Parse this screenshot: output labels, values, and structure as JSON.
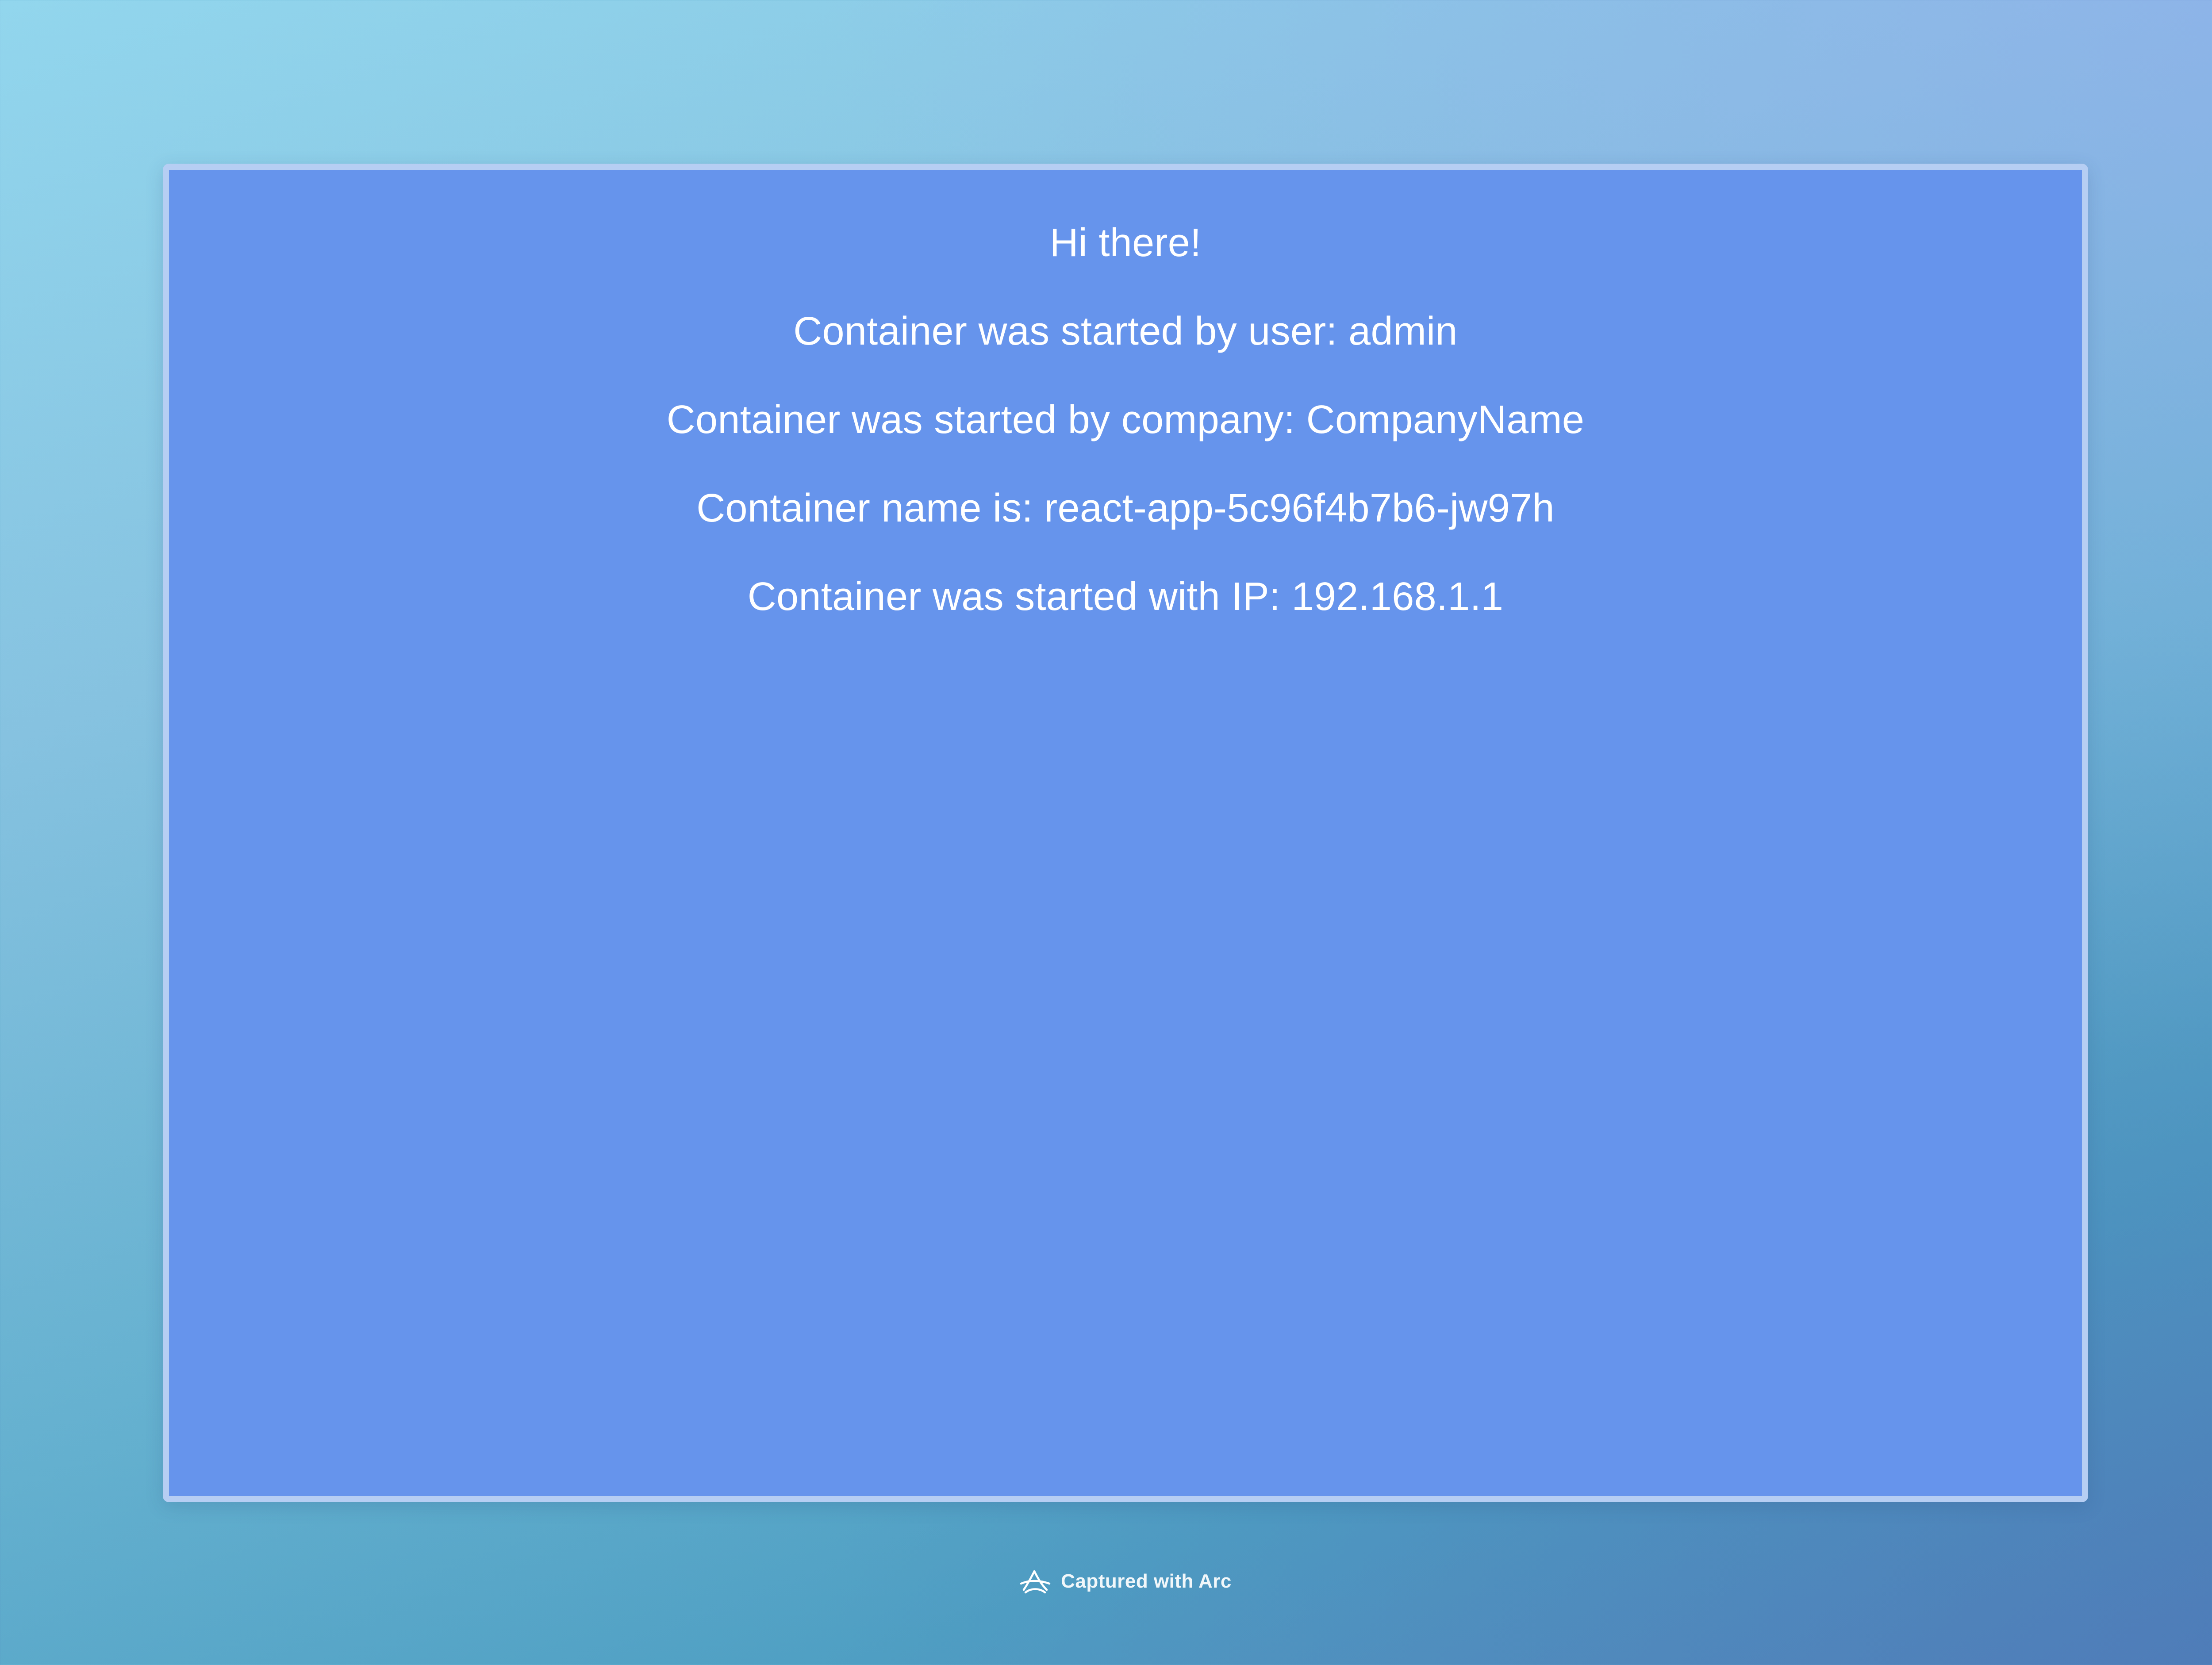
{
  "app": {
    "lines": [
      "Hi there!",
      "Container was started by user: admin",
      "Container was started by company: CompanyName",
      "Container name is: react-app-5c96f4b7b6-jw97h",
      "Container was started with IP: 192.168.1.1"
    ],
    "background_color": "#6694ec",
    "text_color": "#ffffff"
  },
  "footer": {
    "icon": "arc-logo-icon",
    "text": "Captured with Arc"
  }
}
